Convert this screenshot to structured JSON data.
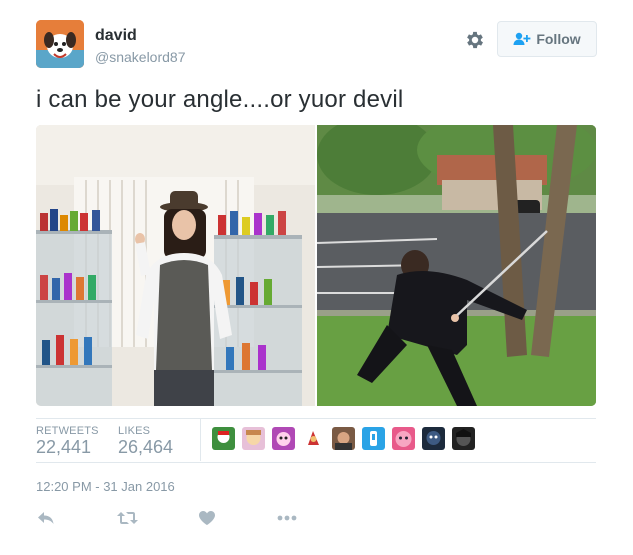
{
  "user": {
    "display_name": "david",
    "handle": "@snakelord87",
    "avatar_icon": "dog-cartoon-avatar"
  },
  "header": {
    "settings_icon": "gear-icon",
    "follow_label": "Follow",
    "follow_icon": "add-user-icon"
  },
  "tweet": {
    "text": "i can be your angle....or yuor devil"
  },
  "media": {
    "photos": [
      {
        "subject": "man in hat and vest beside figurine display cabinets"
      },
      {
        "subject": "man in black holding a sword outdoors"
      }
    ]
  },
  "stats": {
    "retweets_label": "RETWEETS",
    "retweets_count": "22,441",
    "likes_label": "LIKES",
    "likes_count": "26,464",
    "liker_count": 9
  },
  "timestamp": "12:20 PM - 31 Jan 2016",
  "actions": [
    {
      "name": "reply",
      "icon": "reply-icon"
    },
    {
      "name": "retweet",
      "icon": "retweet-icon"
    },
    {
      "name": "like",
      "icon": "heart-icon"
    },
    {
      "name": "more",
      "icon": "more-dots-icon"
    }
  ],
  "colors": {
    "text": "#292f33",
    "muted": "#8899a6",
    "action_icon": "#aab8c2",
    "border": "#e1e8ed"
  }
}
